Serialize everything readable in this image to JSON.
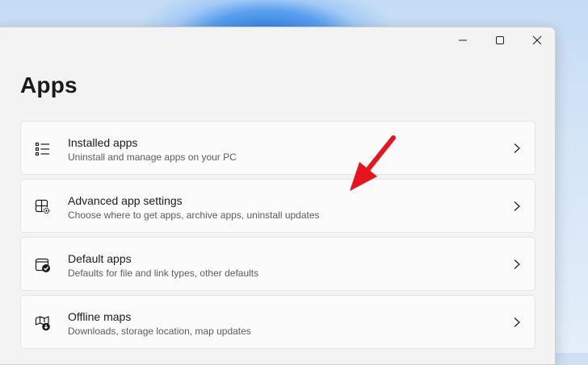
{
  "page": {
    "title": "Apps"
  },
  "window_controls": {
    "minimize_icon": "minimize-icon",
    "maximize_icon": "maximize-icon",
    "close_icon": "close-icon"
  },
  "cards": [
    {
      "title": "Installed apps",
      "description": "Uninstall and manage apps on your PC",
      "icon": "installed-apps-list-icon"
    },
    {
      "title": "Advanced app settings",
      "description": "Choose where to get apps, archive apps, uninstall updates",
      "icon": "advanced-app-settings-icon"
    },
    {
      "title": "Default apps",
      "description": "Defaults for file and link types, other defaults",
      "icon": "default-apps-icon"
    },
    {
      "title": "Offline maps",
      "description": "Downloads, storage location, map updates",
      "icon": "offline-maps-icon"
    }
  ],
  "colors": {
    "annotation_arrow": "#e8141b",
    "background": "#f3f3f3",
    "card": "#fbfbfb"
  }
}
